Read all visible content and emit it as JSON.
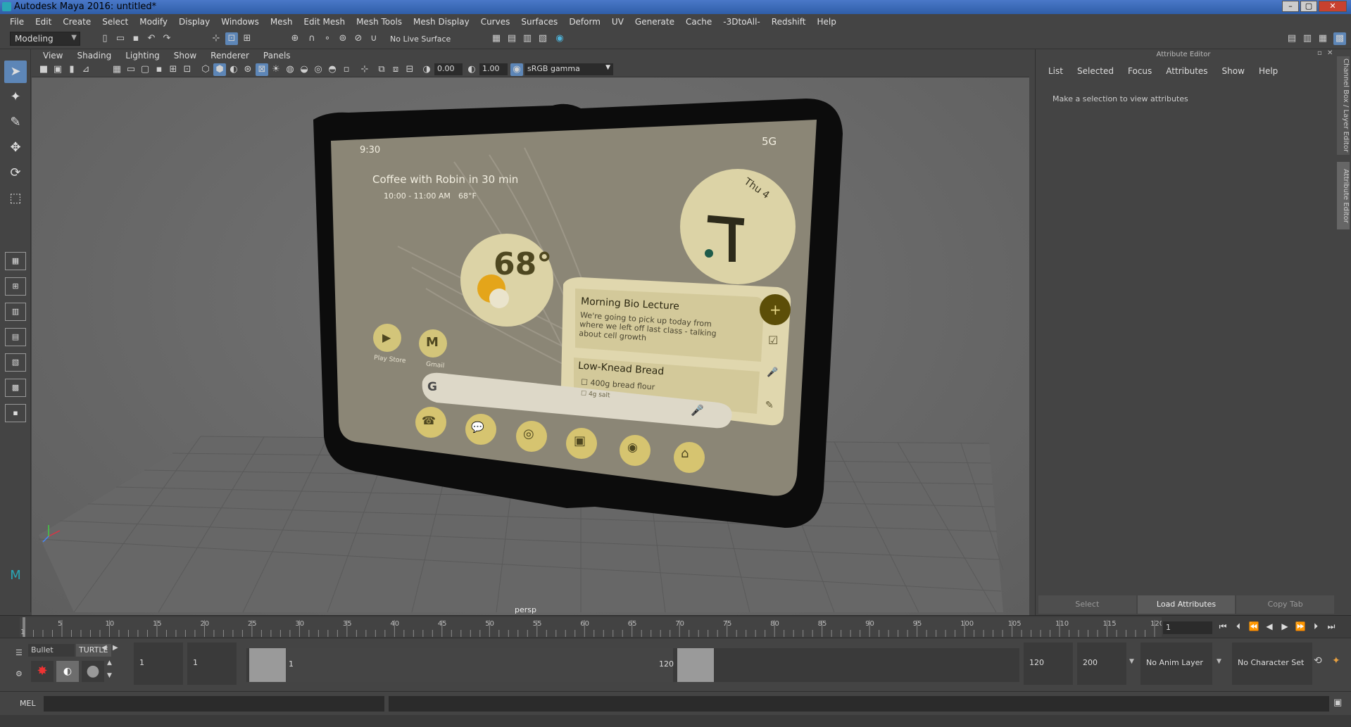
{
  "window": {
    "title": "Autodesk Maya 2016: untitled*",
    "buttons": [
      "–",
      "▢",
      "✕"
    ]
  },
  "menubar": [
    "File",
    "Edit",
    "Create",
    "Select",
    "Modify",
    "Display",
    "Windows",
    "Mesh",
    "Edit Mesh",
    "Mesh Tools",
    "Mesh Display",
    "Curves",
    "Surfaces",
    "Deform",
    "UV",
    "Generate",
    "Cache",
    "-3DtoAll-",
    "Redshift",
    "Help"
  ],
  "statusline": {
    "mode": "Modeling",
    "live_surface": "No Live Surface"
  },
  "viewport": {
    "menu": [
      "View",
      "Shading",
      "Lighting",
      "Show",
      "Renderer",
      "Panels"
    ],
    "exposure": "0.00",
    "gamma": "1.00",
    "colorspace": "sRGB gamma",
    "camera_label": "persp"
  },
  "phone": {
    "time": "9:30",
    "status": "5G",
    "event_title": "Coffee with Robin in 30 min",
    "event_time": "10:00 - 11:00 AM",
    "event_temp": "68°F",
    "clock_day": "Thu 4",
    "clock_hour": "7",
    "weather_temp": "68°",
    "apps": [
      {
        "label": "Play Store",
        "glyph": "▶"
      },
      {
        "label": "Gmail",
        "glyph": "M"
      }
    ],
    "note1_title": "Morning Bio Lecture",
    "note1_body": "We're going to pick up today from where we left off last class - talking about cell growth",
    "note2_title": "Low-Knead Bread",
    "note2_item": "400g bread flour",
    "note2_item2": "4g salt",
    "search_glyph": "G",
    "dock": [
      "☎",
      "💬",
      "◎",
      "▣",
      "◉",
      "⌂"
    ],
    "note_actions": [
      "+",
      "☑",
      "🎤",
      "✎"
    ]
  },
  "attribute_editor": {
    "header": "Attribute Editor",
    "menu": [
      "List",
      "Selected",
      "Focus",
      "Attributes",
      "Show",
      "Help"
    ],
    "message": "Make a selection to view attributes",
    "buttons": [
      "Select",
      "Load Attributes",
      "Copy Tab"
    ],
    "side_tabs": [
      "Channel Box / Layer Editor",
      "Attribute Editor"
    ]
  },
  "timeline": {
    "ticks": [
      "1",
      "5",
      "10",
      "15",
      "20",
      "25",
      "30",
      "35",
      "40",
      "45",
      "50",
      "55",
      "60",
      "65",
      "70",
      "75",
      "80",
      "85",
      "90",
      "95",
      "100",
      "105",
      "110",
      "115",
      "120"
    ],
    "current_frame": "1",
    "start": 1,
    "end": 120
  },
  "range": {
    "shelf_tabs": [
      "Bullet",
      "TURTLE"
    ],
    "start_frame": "1",
    "playback_start": "1",
    "range_start_label": "1",
    "range_end_label": "120",
    "playback_end": "120",
    "end_frame": "200",
    "anim_layer": "No Anim Layer",
    "character_set": "No Character Set"
  },
  "cmdline": {
    "label": "MEL"
  }
}
